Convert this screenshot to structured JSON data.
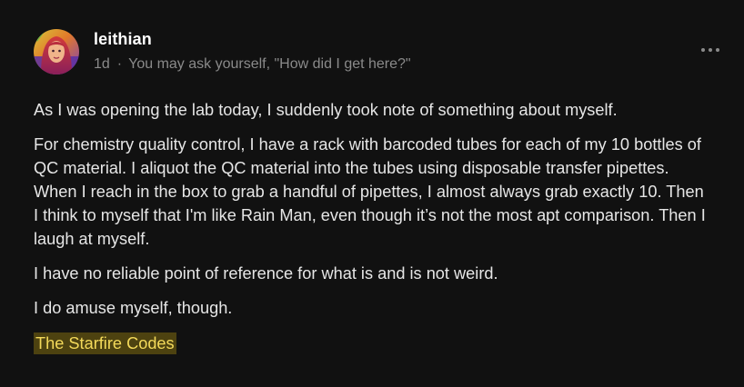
{
  "post": {
    "author": "leithian",
    "age": "1d",
    "separator": "·",
    "tagline": "You may ask yourself, \"How did I get here?\"",
    "more_icon": "ellipsis-icon",
    "paragraphs": [
      "As I was opening the lab today, I suddenly took note of something about myself.",
      "For chemistry quality control, I have a rack with barcoded tubes for each of my 10 bottles of QC material. I aliquot the QC material into the tubes using disposable transfer pipettes. When I reach in the box to grab a handful of pipettes, I almost always grab exactly 10. Then I think to myself that I'm like Rain Man, even though it’s not the most apt comparison. Then I laugh at myself.",
      "I have no reliable point of reference for what is and is not weird.",
      "I do amuse myself, though."
    ],
    "signature": "The Starfire Codes",
    "signature_color": "#f3d95a",
    "signature_bg": "#4d4210"
  },
  "theme": {
    "background": "#111111",
    "text": "#e6e6e6",
    "muted": "#8a8a8a"
  }
}
